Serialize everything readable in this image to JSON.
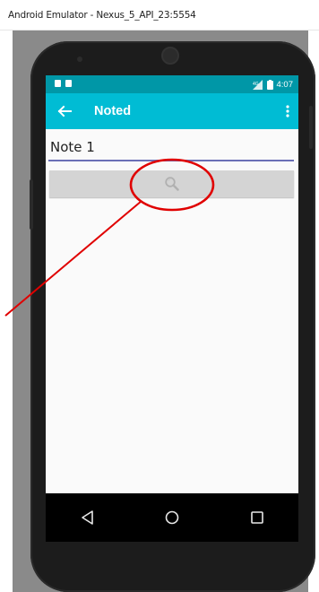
{
  "window": {
    "title": "Android Emulator - Nexus_5_API_23:5554"
  },
  "status_bar": {
    "time": "4:07",
    "network_label": "4G",
    "background": "#0097a7"
  },
  "app_bar": {
    "title": "Noted",
    "background": "#00bcd4",
    "back_icon": "arrow-left-icon",
    "menu_icon": "overflow-menu-icon"
  },
  "note_field": {
    "value": "Note 1",
    "underline_color": "#6a6fb6"
  },
  "search_button": {
    "icon": "search-icon",
    "background": "#d4d4d4"
  },
  "nav_bar": {
    "back_icon": "nav-back-icon",
    "home_icon": "nav-home-icon",
    "recents_icon": "nav-recents-icon"
  },
  "annotation": {
    "color": "#e00000"
  }
}
